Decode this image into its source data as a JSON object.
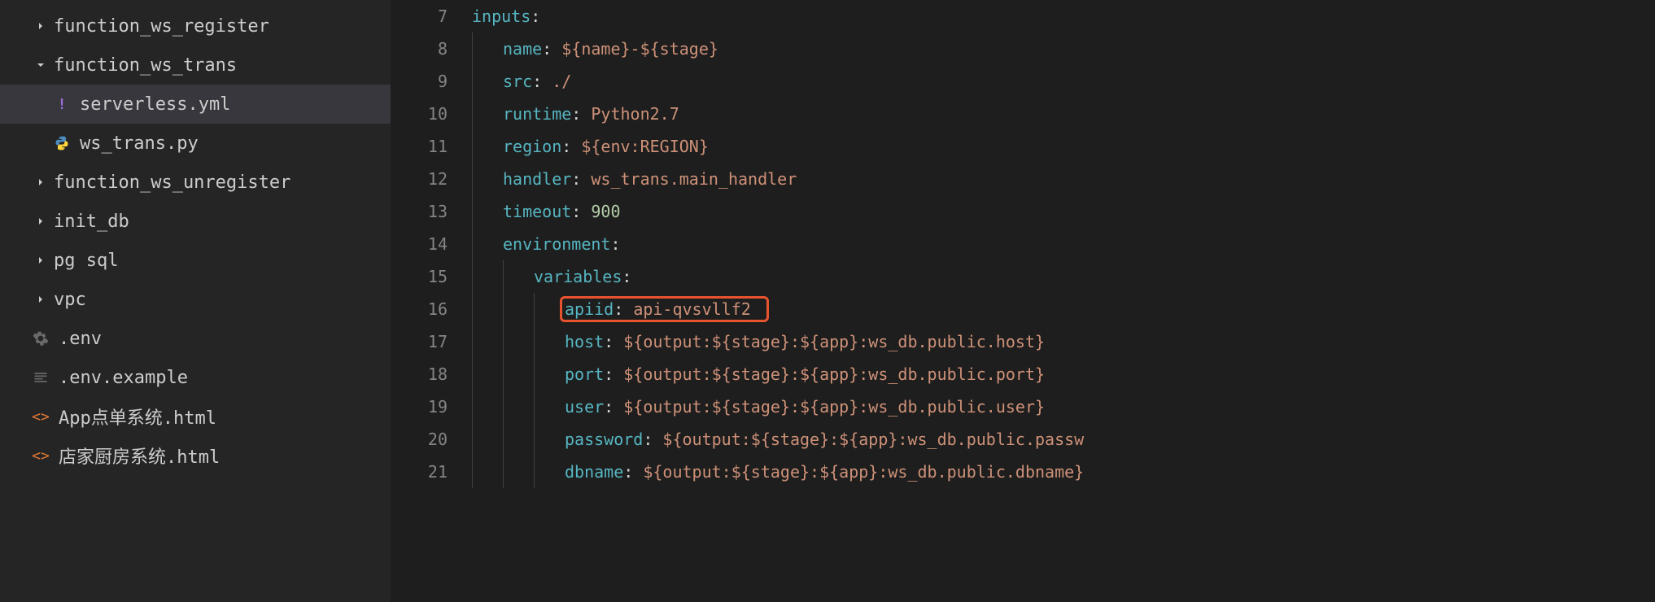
{
  "sidebar": {
    "items": [
      {
        "label": "function_ws_register",
        "type": "folder",
        "expanded": false,
        "indent": 1
      },
      {
        "label": "function_ws_trans",
        "type": "folder",
        "expanded": true,
        "indent": 1
      },
      {
        "label": "serverless.yml",
        "type": "file",
        "icon": "yml",
        "indent": 2,
        "selected": true
      },
      {
        "label": "ws_trans.py",
        "type": "file",
        "icon": "py",
        "indent": 2
      },
      {
        "label": "function_ws_unregister",
        "type": "folder",
        "expanded": false,
        "indent": 1
      },
      {
        "label": "init_db",
        "type": "folder",
        "expanded": false,
        "indent": 1
      },
      {
        "label": "pg sql",
        "type": "folder",
        "expanded": false,
        "indent": 1
      },
      {
        "label": "vpc",
        "type": "folder",
        "expanded": false,
        "indent": 1
      },
      {
        "label": ".env",
        "type": "file",
        "icon": "gear",
        "indent": 1
      },
      {
        "label": ".env.example",
        "type": "file",
        "icon": "lines",
        "indent": 1
      },
      {
        "label": "App点单系统.html",
        "type": "file",
        "icon": "html",
        "indent": 1
      },
      {
        "label": "店家厨房系统.html",
        "type": "file",
        "icon": "html",
        "indent": 1
      }
    ]
  },
  "editor": {
    "lines": [
      {
        "num": "7",
        "indent": 0,
        "tokens": [
          {
            "t": "inputs",
            "c": "yaml-key"
          },
          {
            "t": ":",
            "c": "yaml-plain"
          }
        ]
      },
      {
        "num": "8",
        "indent": 1,
        "tokens": [
          {
            "t": "name",
            "c": "yaml-key"
          },
          {
            "t": ": ",
            "c": "yaml-plain"
          },
          {
            "t": "${name}-${stage}",
            "c": "yaml-value"
          }
        ]
      },
      {
        "num": "9",
        "indent": 1,
        "tokens": [
          {
            "t": "src",
            "c": "yaml-key"
          },
          {
            "t": ": ",
            "c": "yaml-plain"
          },
          {
            "t": "./",
            "c": "yaml-value"
          }
        ]
      },
      {
        "num": "10",
        "indent": 1,
        "tokens": [
          {
            "t": "runtime",
            "c": "yaml-key"
          },
          {
            "t": ": ",
            "c": "yaml-plain"
          },
          {
            "t": "Python2.7",
            "c": "yaml-value"
          }
        ]
      },
      {
        "num": "11",
        "indent": 1,
        "tokens": [
          {
            "t": "region",
            "c": "yaml-key"
          },
          {
            "t": ": ",
            "c": "yaml-plain"
          },
          {
            "t": "${env:REGION}",
            "c": "yaml-value"
          }
        ]
      },
      {
        "num": "12",
        "indent": 1,
        "tokens": [
          {
            "t": "handler",
            "c": "yaml-key"
          },
          {
            "t": ": ",
            "c": "yaml-plain"
          },
          {
            "t": "ws_trans.main_handler",
            "c": "yaml-value"
          }
        ]
      },
      {
        "num": "13",
        "indent": 1,
        "tokens": [
          {
            "t": "timeout",
            "c": "yaml-key"
          },
          {
            "t": ": ",
            "c": "yaml-plain"
          },
          {
            "t": "900",
            "c": "yaml-number"
          }
        ]
      },
      {
        "num": "14",
        "indent": 1,
        "tokens": [
          {
            "t": "environment",
            "c": "yaml-key"
          },
          {
            "t": ":",
            "c": "yaml-plain"
          }
        ]
      },
      {
        "num": "15",
        "indent": 2,
        "tokens": [
          {
            "t": "variables",
            "c": "yaml-key"
          },
          {
            "t": ":",
            "c": "yaml-plain"
          }
        ]
      },
      {
        "num": "16",
        "indent": 3,
        "tokens": [
          {
            "t": "apiid",
            "c": "yaml-key"
          },
          {
            "t": ": ",
            "c": "yaml-plain"
          },
          {
            "t": "api-qvsvllf2",
            "c": "yaml-value"
          }
        ],
        "highlighted": true
      },
      {
        "num": "17",
        "indent": 3,
        "tokens": [
          {
            "t": "host",
            "c": "yaml-key"
          },
          {
            "t": ": ",
            "c": "yaml-plain"
          },
          {
            "t": "${output:${stage}:${app}:ws_db.public.host}",
            "c": "yaml-value"
          }
        ]
      },
      {
        "num": "18",
        "indent": 3,
        "tokens": [
          {
            "t": "port",
            "c": "yaml-key"
          },
          {
            "t": ": ",
            "c": "yaml-plain"
          },
          {
            "t": "${output:${stage}:${app}:ws_db.public.port}",
            "c": "yaml-value"
          }
        ]
      },
      {
        "num": "19",
        "indent": 3,
        "tokens": [
          {
            "t": "user",
            "c": "yaml-key"
          },
          {
            "t": ": ",
            "c": "yaml-plain"
          },
          {
            "t": "${output:${stage}:${app}:ws_db.public.user}",
            "c": "yaml-value"
          }
        ]
      },
      {
        "num": "20",
        "indent": 3,
        "tokens": [
          {
            "t": "password",
            "c": "yaml-key"
          },
          {
            "t": ": ",
            "c": "yaml-plain"
          },
          {
            "t": "${output:${stage}:${app}:ws_db.public.passw",
            "c": "yaml-value"
          }
        ]
      },
      {
        "num": "21",
        "indent": 3,
        "tokens": [
          {
            "t": "dbname",
            "c": "yaml-key"
          },
          {
            "t": ": ",
            "c": "yaml-plain"
          },
          {
            "t": "${output:${stage}:${app}:ws_db.public.dbname}",
            "c": "yaml-value"
          }
        ]
      }
    ]
  }
}
